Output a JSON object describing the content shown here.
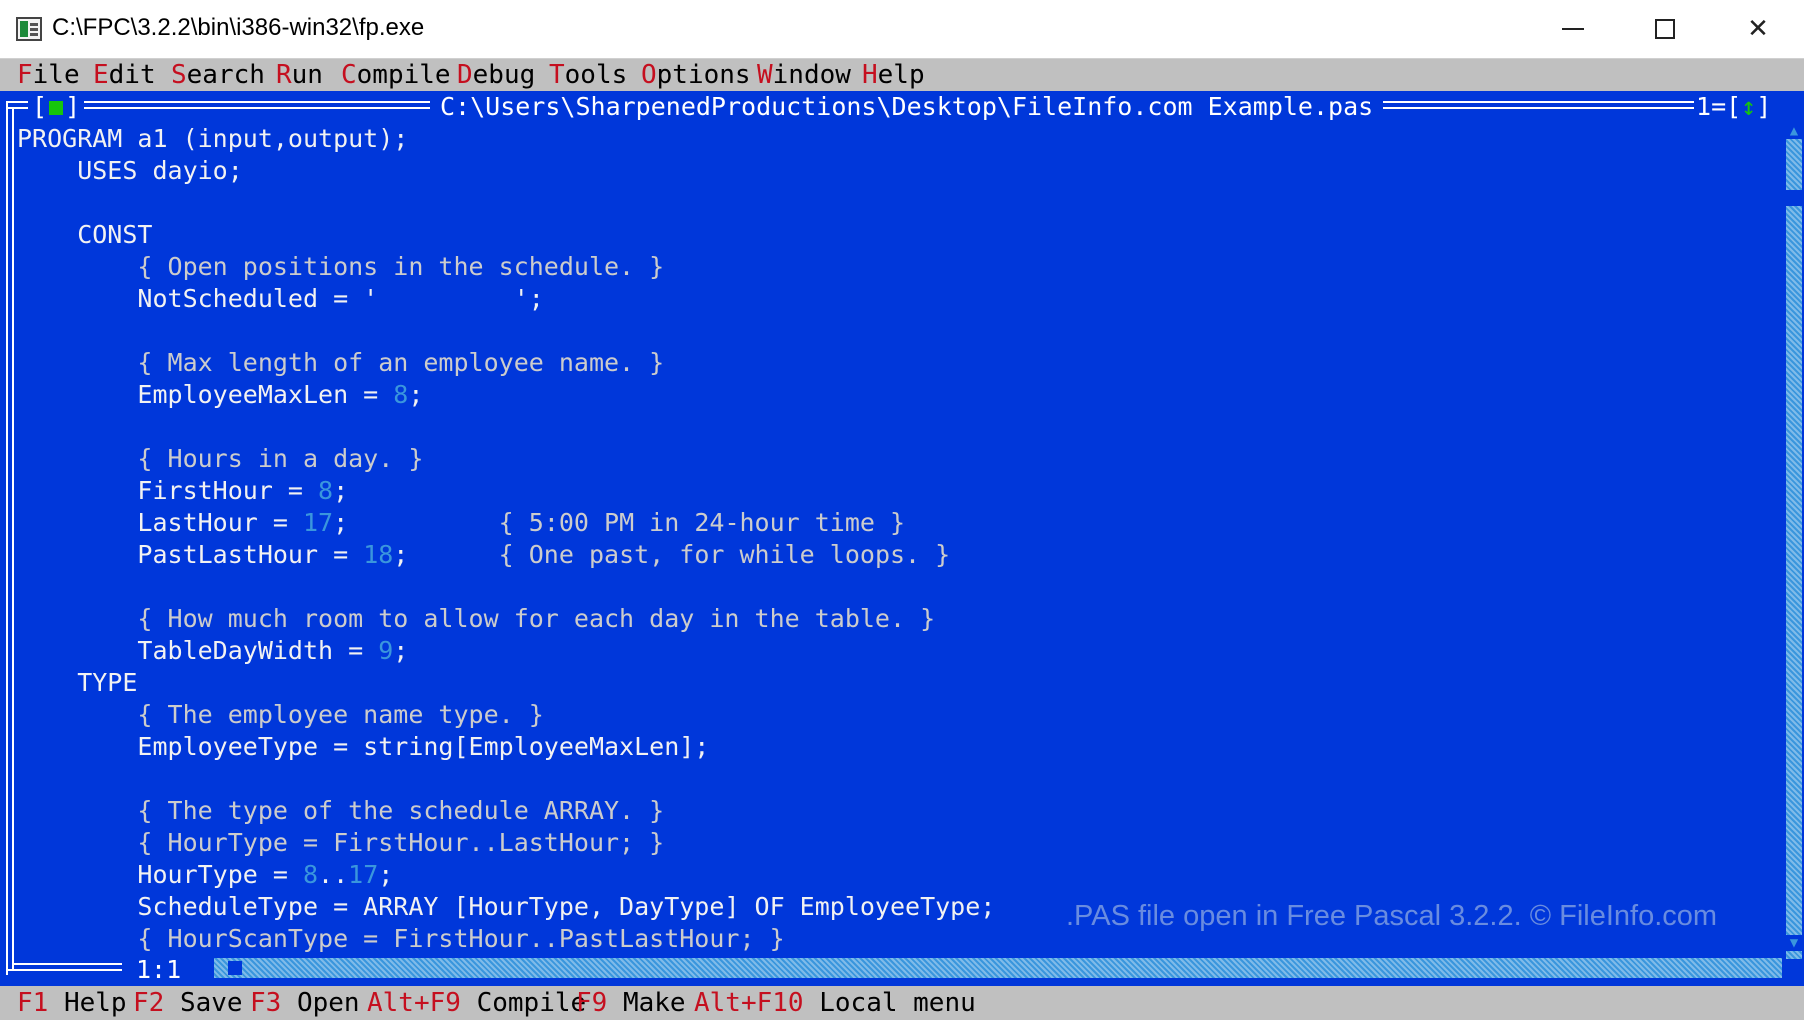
{
  "window": {
    "title": "C:\\FPC\\3.2.2\\bin\\i386-win32\\fp.exe",
    "icon": "terminal-app-icon",
    "controls": [
      "minimize-icon",
      "maximize-icon",
      "close-icon"
    ],
    "close_glyph": "✕"
  },
  "menu": [
    {
      "hot": "F",
      "rest": "ile"
    },
    {
      "hot": "E",
      "rest": "dit"
    },
    {
      "hot": "S",
      "rest": "earch"
    },
    {
      "hot": "R",
      "rest": "un"
    },
    {
      "hot": "C",
      "rest": "ompile"
    },
    {
      "hot": "D",
      "rest": "ebug"
    },
    {
      "hot": "T",
      "rest": "ools"
    },
    {
      "hot": "O",
      "rest": "ptions"
    },
    {
      "hot": "W",
      "rest": "indow"
    },
    {
      "hot": "H",
      "rest": "elp"
    }
  ],
  "editor": {
    "file_path": "C:\\Users\\SharpenedProductions\\Desktop\\FileInfo.com Example.pas",
    "window_number": "1",
    "close_left": "[",
    "close_right": "]",
    "zoom_glyph": "↕",
    "cursor_position": "1:1",
    "code": [
      [
        {
          "t": "PROGRAM a1 (input,output);",
          "c": "kw"
        }
      ],
      [
        {
          "t": "    USES dayio;",
          "c": "kw"
        }
      ],
      [
        {
          "t": "",
          "c": "kw"
        }
      ],
      [
        {
          "t": "    CONST",
          "c": "kw"
        }
      ],
      [
        {
          "t": "        { Open positions in the schedule. }",
          "c": "cmt"
        }
      ],
      [
        {
          "t": "        NotScheduled = '         ';",
          "c": "kw"
        }
      ],
      [
        {
          "t": "",
          "c": "kw"
        }
      ],
      [
        {
          "t": "        { Max length of an employee name. }",
          "c": "cmt"
        }
      ],
      [
        {
          "t": "        EmployeeMaxLen = ",
          "c": "kw"
        },
        {
          "t": "8",
          "c": "num"
        },
        {
          "t": ";",
          "c": "kw"
        }
      ],
      [
        {
          "t": "",
          "c": "kw"
        }
      ],
      [
        {
          "t": "        { Hours in a day. }",
          "c": "cmt"
        }
      ],
      [
        {
          "t": "        FirstHour = ",
          "c": "kw"
        },
        {
          "t": "8",
          "c": "num"
        },
        {
          "t": ";",
          "c": "kw"
        }
      ],
      [
        {
          "t": "        LastHour = ",
          "c": "kw"
        },
        {
          "t": "17",
          "c": "num"
        },
        {
          "t": ";          ",
          "c": "kw"
        },
        {
          "t": "{ 5:00 PM in 24-hour time }",
          "c": "cmt"
        }
      ],
      [
        {
          "t": "        PastLastHour = ",
          "c": "kw"
        },
        {
          "t": "18",
          "c": "num"
        },
        {
          "t": ";      ",
          "c": "kw"
        },
        {
          "t": "{ One past, for while loops. }",
          "c": "cmt"
        }
      ],
      [
        {
          "t": "",
          "c": "kw"
        }
      ],
      [
        {
          "t": "        { How much room to allow for each day in the table. }",
          "c": "cmt"
        }
      ],
      [
        {
          "t": "        TableDayWidth = ",
          "c": "kw"
        },
        {
          "t": "9",
          "c": "num"
        },
        {
          "t": ";",
          "c": "kw"
        }
      ],
      [
        {
          "t": "    TYPE",
          "c": "kw"
        }
      ],
      [
        {
          "t": "        { The employee name type. }",
          "c": "cmt"
        }
      ],
      [
        {
          "t": "        EmployeeType = string[EmployeeMaxLen];",
          "c": "kw"
        }
      ],
      [
        {
          "t": "",
          "c": "kw"
        }
      ],
      [
        {
          "t": "        { The type of the schedule ARRAY. }",
          "c": "cmt"
        }
      ],
      [
        {
          "t": "        { HourType = FirstHour..LastHour; }",
          "c": "cmt"
        }
      ],
      [
        {
          "t": "        HourType = ",
          "c": "kw"
        },
        {
          "t": "8",
          "c": "num"
        },
        {
          "t": "..",
          "c": "kw"
        },
        {
          "t": "17",
          "c": "num"
        },
        {
          "t": ";",
          "c": "kw"
        }
      ],
      [
        {
          "t": "        ScheduleType = ARRAY [HourType, DayType] OF EmployeeType;",
          "c": "kw"
        }
      ],
      [
        {
          "t": "        { HourScanType = FirstHour..PastLastHour; }",
          "c": "cmt"
        }
      ]
    ]
  },
  "watermark": ".PAS file open in Free Pascal 3.2.2. © FileInfo.com",
  "statusbar": [
    {
      "key": "F1",
      "label": " Help"
    },
    {
      "key": "F2",
      "label": " Save"
    },
    {
      "key": "F3",
      "label": " Open"
    },
    {
      "key": "Alt+F9",
      "label": " Compile"
    },
    {
      "key": "F9",
      "label": " Make"
    },
    {
      "key": "Alt+F10",
      "label": " Local menu"
    }
  ],
  "colors": {
    "editor_bg": "#0037da",
    "menu_bg": "#c0c0c0",
    "hotkey": "#c50f1f",
    "number": "#3a96dd",
    "comment": "#cccccc",
    "text": "#f2f2f2"
  }
}
